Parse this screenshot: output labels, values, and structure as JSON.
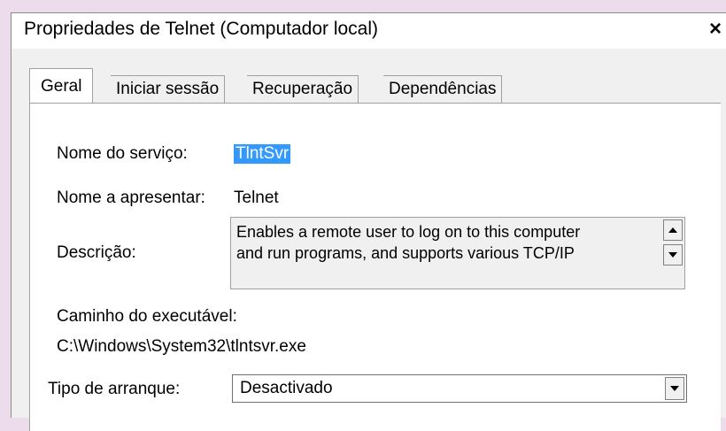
{
  "window": {
    "title": "Propriedades de Telnet (Computador local)",
    "close_symbol": "×"
  },
  "tabs": [
    {
      "label": "Geral",
      "active": true
    },
    {
      "label": "Iniciar sessão",
      "active": false
    },
    {
      "label": "Recuperação",
      "active": false
    },
    {
      "label": "Dependências",
      "active": false
    }
  ],
  "general": {
    "service_name_label": "Nome do serviço:",
    "service_name_value": "TlntSvr",
    "display_name_label": "Nome a apresentar:",
    "display_name_value": "Telnet",
    "description_label": "Descrição:",
    "description_line1": "Enables a remote user to log on to this computer",
    "description_line2": "and run programs, and supports various TCP/IP",
    "exe_path_label": "Caminho do executável:",
    "exe_path_value": "C:\\Windows\\System32\\tlntsvr.exe",
    "startup_type_label": "Tipo de arranque:",
    "startup_type_value": "Desactivado"
  },
  "icons": {
    "scroll_up": "scroll-up-arrow-icon",
    "scroll_down": "scroll-down-arrow-icon",
    "dropdown": "dropdown-arrow-icon"
  },
  "colors": {
    "selection": "#3399ff",
    "dialog_bg": "#f0f0f0",
    "desktop_bg": "#ecdcec"
  }
}
